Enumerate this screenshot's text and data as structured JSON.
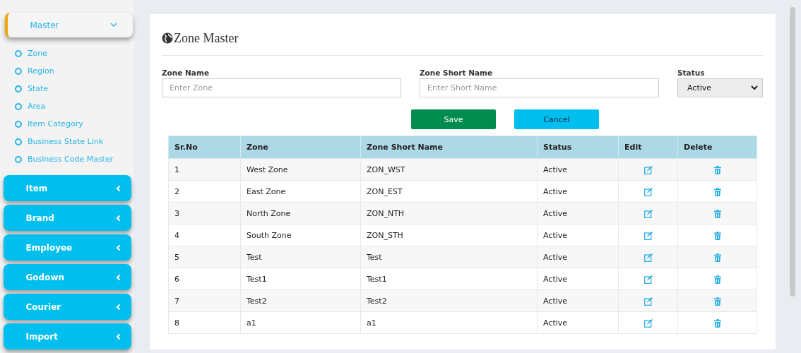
{
  "sidebar": {
    "items": [
      {
        "label": "Master",
        "expanded": true,
        "children": [
          {
            "label": "Zone"
          },
          {
            "label": "Region"
          },
          {
            "label": "State"
          },
          {
            "label": "Area"
          },
          {
            "label": "Item Category"
          },
          {
            "label": "Business State Link"
          },
          {
            "label": "Business Code Master"
          }
        ]
      },
      {
        "label": "Item",
        "expanded": false
      },
      {
        "label": "Brand",
        "expanded": false
      },
      {
        "label": "Employee",
        "expanded": false
      },
      {
        "label": "Godown",
        "expanded": false
      },
      {
        "label": "Courier",
        "expanded": false
      },
      {
        "label": "Import",
        "expanded": false
      }
    ]
  },
  "page": {
    "title": "Zone Master",
    "fields": [
      {
        "kind": "text",
        "label": "Zone Name",
        "placeholder": "Enter Zone"
      },
      {
        "kind": "text",
        "label": "Zone Short Name",
        "placeholder": "Enter Short Name"
      },
      {
        "kind": "select",
        "label": "Status",
        "value": "Active"
      }
    ],
    "buttons": [
      {
        "kind": "save",
        "label": "Save"
      },
      {
        "kind": "cancel",
        "label": "Cancel"
      }
    ],
    "table": {
      "columns": [
        "Sr.No",
        "Zone",
        "Zone Short Name",
        "Status",
        "Edit",
        "Delete"
      ],
      "rows": [
        [
          "1",
          "West Zone",
          "ZON_WST",
          "Active"
        ],
        [
          "2",
          "East Zone",
          "ZON_EST",
          "Active"
        ],
        [
          "3",
          "North Zone",
          "ZON_NTH",
          "Active"
        ],
        [
          "4",
          "South Zone",
          "ZON_STH",
          "Active"
        ],
        [
          "5",
          "Test",
          "Test",
          "Active"
        ],
        [
          "6",
          "Test1",
          "Test1",
          "Active"
        ],
        [
          "7",
          "Test2",
          "Test2",
          "Active"
        ],
        [
          "8",
          "a1",
          "a1",
          "Active"
        ]
      ]
    }
  }
}
